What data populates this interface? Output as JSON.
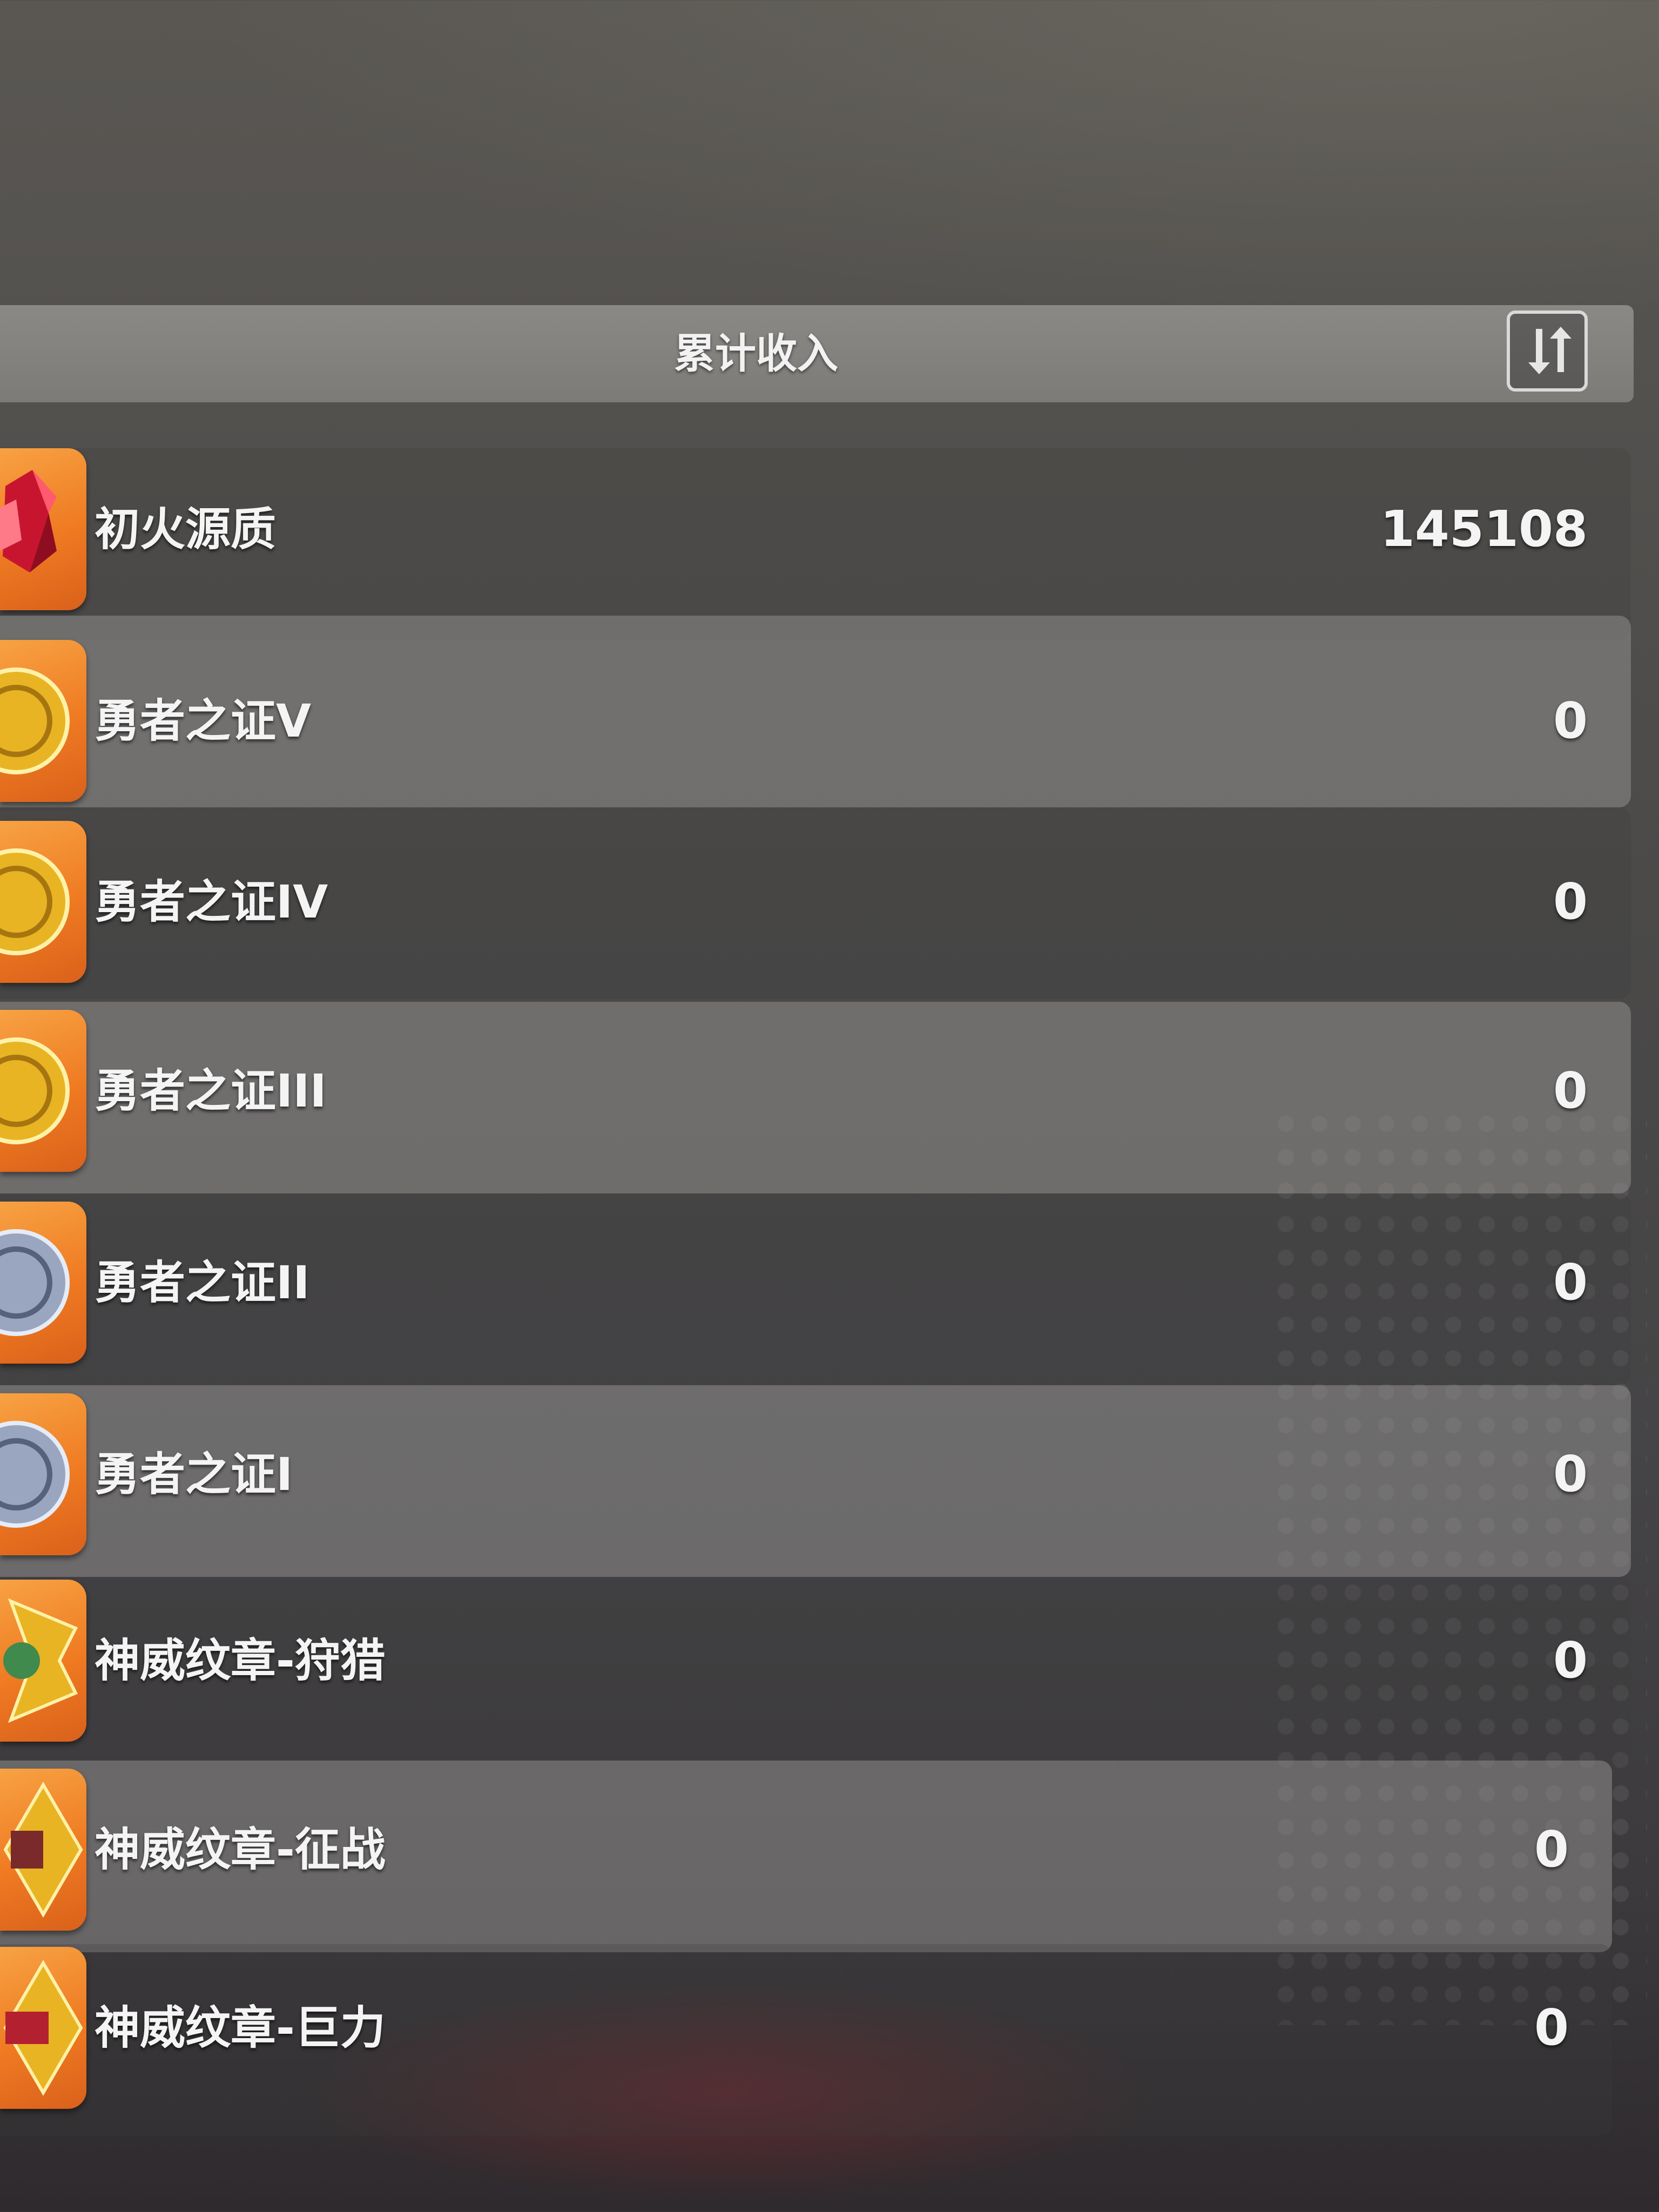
{
  "header": {
    "title": "累计收入"
  },
  "items": [
    {
      "name": "初火源质",
      "value": "145108",
      "icon": "red-crystal-icon",
      "color": "#d8283f"
    },
    {
      "name": "勇者之证V",
      "value": "0",
      "icon": "gold-medal-icon",
      "color": "#e9b423"
    },
    {
      "name": "勇者之证IV",
      "value": "0",
      "icon": "gold-medal-icon",
      "color": "#e9b423"
    },
    {
      "name": "勇者之证III",
      "value": "0",
      "icon": "gold-medal-icon",
      "color": "#e9b423"
    },
    {
      "name": "勇者之证II",
      "value": "0",
      "icon": "silver-medal-icon",
      "color": "#9aa6c0"
    },
    {
      "name": "勇者之证I",
      "value": "0",
      "icon": "silver-medal-icon",
      "color": "#9aa6c0"
    },
    {
      "name": "神威纹章-狩猎",
      "value": "0",
      "icon": "emblem-hunt-icon",
      "color": "#e9b423"
    },
    {
      "name": "神威纹章-征战",
      "value": "0",
      "icon": "emblem-war-icon",
      "color": "#e9b423"
    },
    {
      "name": "神威纹章-巨力",
      "value": "0",
      "icon": "emblem-might-icon",
      "color": "#e9b423"
    }
  ]
}
